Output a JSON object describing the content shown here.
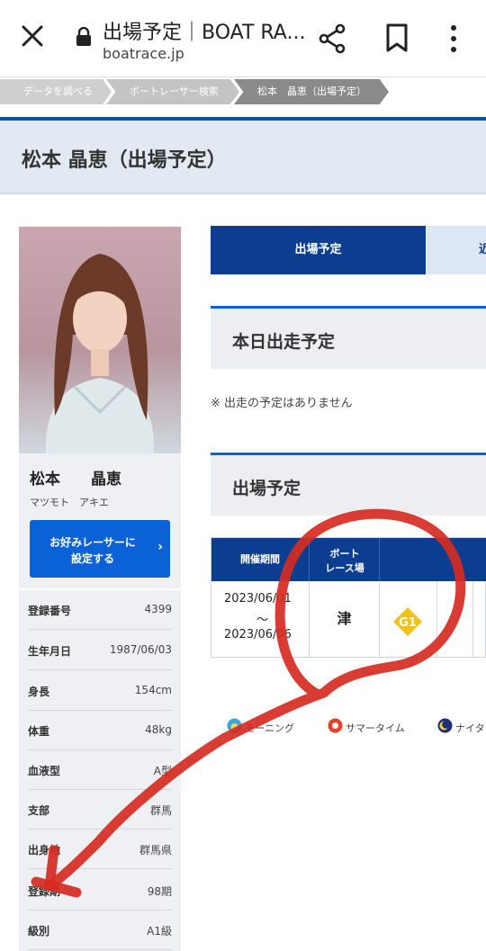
{
  "browser": {
    "title": "出場予定｜BOAT RA...",
    "url": "boatrace.jp"
  },
  "breadcrumb": [
    "データを調べる",
    "ボートレーサー検索",
    "松本　晶恵（出場予定）"
  ],
  "page_title": "松本 晶恵（出場予定）",
  "profile": {
    "name": "松本　　晶恵",
    "kana": "マツモト　アキエ",
    "favorite_line1": "お好みレーサーに",
    "favorite_line2": "設定する",
    "favorite_arrow": "›"
  },
  "info": [
    {
      "label": "登録番号",
      "value": "4399"
    },
    {
      "label": "生年月日",
      "value": "1987/06/03"
    },
    {
      "label": "身長",
      "value": "154cm"
    },
    {
      "label": "体重",
      "value": "48kg"
    },
    {
      "label": "血液型",
      "value": "A型"
    },
    {
      "label": "支部",
      "value": "群馬"
    },
    {
      "label": "出身地",
      "value": "群馬県"
    },
    {
      "label": "登録期",
      "value": "98期"
    },
    {
      "label": "級別",
      "value": "A1級"
    }
  ],
  "tabs": {
    "active": "出場予定",
    "inactive": "近"
  },
  "today": {
    "heading": "本日出走予定",
    "note": "※ 出走の予定はありません"
  },
  "schedule": {
    "heading": "出場予定",
    "col_period": "開催期間",
    "col_venue_1": "ボート",
    "col_venue_2": "レース場",
    "row": {
      "start": "2023/06/01",
      "tilde": "〜",
      "end": "2023/06/06",
      "venue": "津",
      "grade": "G1"
    }
  },
  "legend": {
    "morning": "モーニング",
    "summer": "サマータイム",
    "night": "ナイター"
  },
  "colors": {
    "brand_blue": "#0b3e91",
    "button_blue": "#0b62d6",
    "grade_yellow": "#f2c21b",
    "annotation_red": "#d62b22"
  }
}
